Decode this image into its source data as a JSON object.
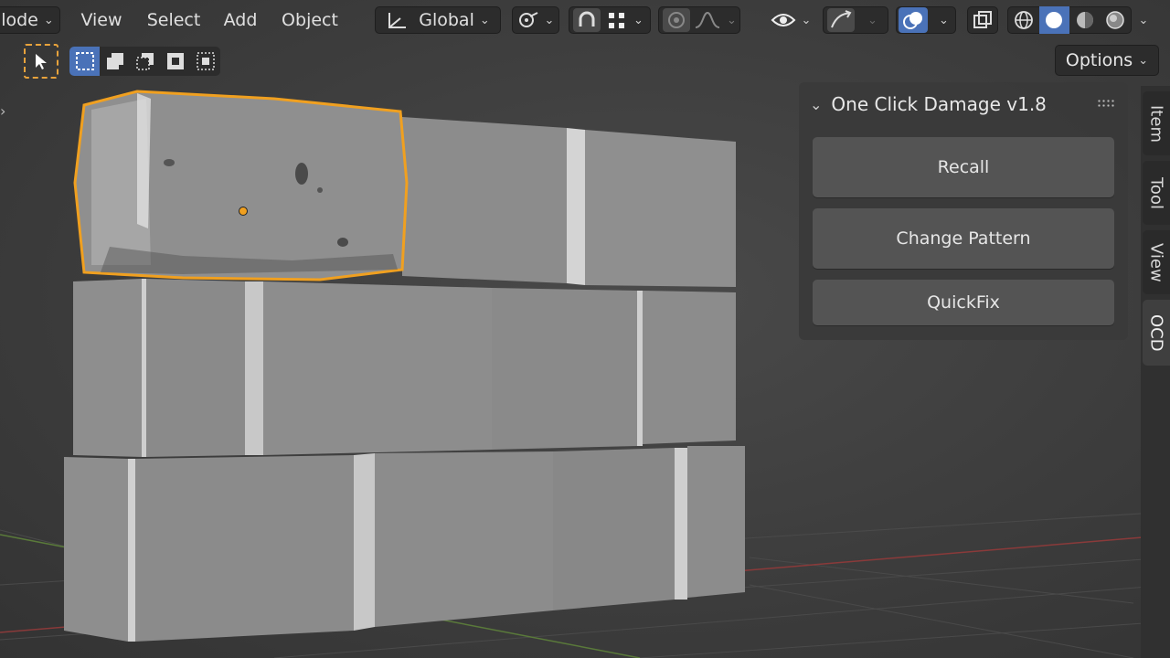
{
  "header": {
    "mode_label": "lode",
    "menus": [
      "View",
      "Select",
      "Add",
      "Object"
    ],
    "orientation": {
      "label": "Global",
      "icon": "transform-orientation-icon"
    },
    "pivot_icon": "pivot-point-icon",
    "snap_icon": "snap-magnet-icon",
    "snap_target_icon": "snap-increment-icon",
    "proportional_icon": "proportional-edit-icon",
    "falloff_icon": "falloff-curve-icon",
    "visibility_icon": "eye-visibility-icon",
    "gizmo_icon": "gizmo-icon",
    "overlay_icon": "overlays-icon",
    "xray_icon": "xray-icon",
    "shading_modes": [
      "wireframe-shading-icon",
      "solid-shading-icon",
      "material-shading-icon",
      "rendered-shading-icon"
    ]
  },
  "toolbar": {
    "select_tool_icon": "select-cursor-icon",
    "select_modes": [
      "select-new-icon",
      "select-extend-icon",
      "select-subtract-icon",
      "select-invert-icon",
      "select-intersect-icon"
    ],
    "options_label": "Options"
  },
  "panel": {
    "title": "One Click Damage v1.8",
    "buttons": [
      "Recall",
      "Change Pattern",
      "QuickFix"
    ]
  },
  "tabs": [
    "Item",
    "Tool",
    "View",
    "OCD"
  ],
  "colors": {
    "accent_blue": "#4a72b8",
    "selection_orange": "#f0a020"
  }
}
